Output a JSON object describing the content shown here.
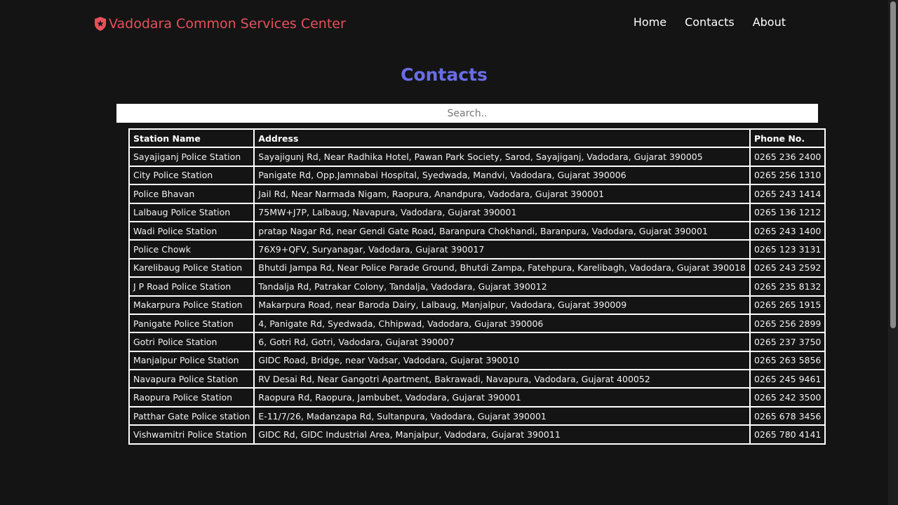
{
  "brand": {
    "name": "Vadodara Common Services Center",
    "icon": "police-badge-icon",
    "color": "#e8505b"
  },
  "nav": {
    "links": [
      "Home",
      "Contacts",
      "About"
    ]
  },
  "page_title": "Contacts",
  "accent_color": "#6a6de5",
  "search": {
    "placeholder": "Search..",
    "value": ""
  },
  "table": {
    "headers": [
      "Station Name",
      "Address",
      "Phone No."
    ],
    "rows": [
      [
        "Sayajiganj Police Station",
        "Sayajigunj Rd, Near Radhika Hotel, Pawan Park Society, Sarod, Sayajiganj, Vadodara, Gujarat 390005",
        "0265 236 2400"
      ],
      [
        "City Police Station",
        "Panigate Rd, Opp.Jamnabai Hospital, Syedwada, Mandvi, Vadodara, Gujarat 390006",
        "0265 256 1310"
      ],
      [
        "Police Bhavan",
        "Jail Rd, Near Narmada Nigam, Raopura, Anandpura, Vadodara, Gujarat 390001",
        "0265 243 1414"
      ],
      [
        "Lalbaug Police Station",
        "75MW+J7P, Lalbaug, Navapura, Vadodara, Gujarat 390001",
        "0265 136 1212"
      ],
      [
        "Wadi Police Station",
        "pratap Nagar Rd, near Gendi Gate Road, Baranpura Chokhandi, Baranpura, Vadodara, Gujarat 390001",
        "0265 243 1400"
      ],
      [
        "Police Chowk",
        "76X9+QFV, Suryanagar, Vadodara, Gujarat 390017",
        "0265 123 3131"
      ],
      [
        "Karelibaug Police Station",
        "Bhutdi Jampa Rd, Near Police Parade Ground, Bhutdi Zampa, Fatehpura, Karelibagh, Vadodara, Gujarat 390018",
        "0265 243 2592"
      ],
      [
        "J P Road Police Station",
        "Tandalja Rd, Patrakar Colony, Tandalja, Vadodara, Gujarat 390012",
        "0265 235 8132"
      ],
      [
        "Makarpura Police Station",
        "Makarpura Road, near Baroda Dairy, Lalbaug, Manjalpur, Vadodara, Gujarat 390009",
        "0265 265 1915"
      ],
      [
        "Panigate Police Station",
        "4, Panigate Rd, Syedwada, Chhipwad, Vadodara, Gujarat 390006",
        "0265 256 2899"
      ],
      [
        "Gotri Police Station",
        "6, Gotri Rd, Gotri, Vadodara, Gujarat 390007",
        "0265 237 3750"
      ],
      [
        "Manjalpur Police Station",
        "GIDC Road, Bridge, near Vadsar, Vadodara, Gujarat 390010",
        "0265 263 5856"
      ],
      [
        "Navapura Police Station",
        "RV Desai Rd, Near Gangotri Apartment, Bakrawadi, Navapura, Vadodara, Gujarat 400052",
        "0265 245 9461"
      ],
      [
        "Raopura Police Station",
        "Raopura Rd, Raopura, Jambubet, Vadodara, Gujarat 390001",
        "0265 242 3500"
      ],
      [
        "Patthar Gate Police station",
        "E-11/7/26, Madanzapa Rd, Sultanpura, Vadodara, Gujarat 390001",
        "0265 678 3456"
      ],
      [
        "Vishwamitri Police Station",
        "GIDC Rd, GIDC Industrial Area, Manjalpur, Vadodara, Gujarat 390011",
        "0265 780 4141"
      ]
    ]
  }
}
